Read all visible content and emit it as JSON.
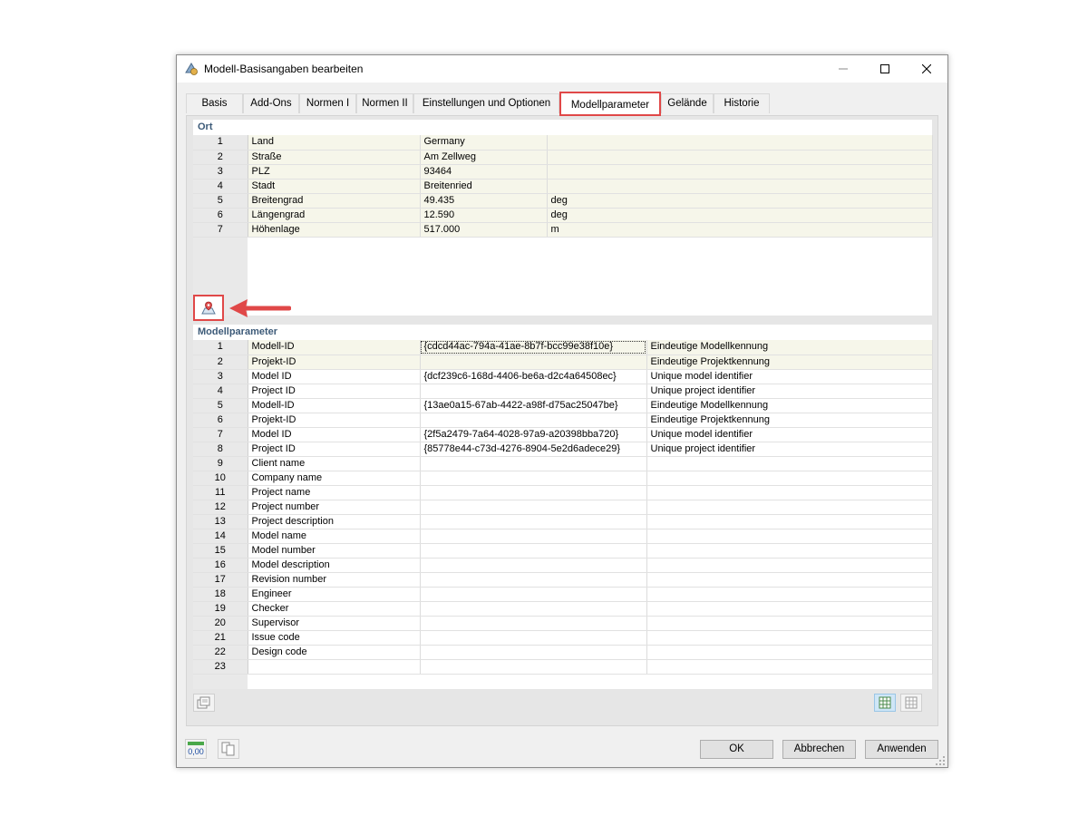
{
  "window": {
    "title": "Modell-Basisangaben bearbeiten"
  },
  "tabs": [
    {
      "label": "Basis"
    },
    {
      "label": "Add-Ons"
    },
    {
      "label": "Normen I"
    },
    {
      "label": "Normen II"
    },
    {
      "label": "Einstellungen und Optionen"
    },
    {
      "label": "Modellparameter",
      "active": true
    },
    {
      "label": "Gelände"
    },
    {
      "label": "Historie"
    }
  ],
  "ort": {
    "title": "Ort",
    "rows": [
      {
        "num": "1",
        "name": "Land",
        "value": "Germany",
        "unit": ""
      },
      {
        "num": "2",
        "name": "Straße",
        "value": "Am Zellweg",
        "unit": ""
      },
      {
        "num": "3",
        "name": "PLZ",
        "value": "93464",
        "unit": ""
      },
      {
        "num": "4",
        "name": "Stadt",
        "value": "Breitenried",
        "unit": ""
      },
      {
        "num": "5",
        "name": "Breitengrad",
        "value": "49.435",
        "unit": "deg"
      },
      {
        "num": "6",
        "name": "Längengrad",
        "value": "12.590",
        "unit": "deg"
      },
      {
        "num": "7",
        "name": "Höhenlage",
        "value": "517.000",
        "unit": "m"
      }
    ]
  },
  "params": {
    "title": "Modellparameter",
    "rows": [
      {
        "num": "1",
        "name": "Modell-ID",
        "value": "{cdcd44ac-794a-41ae-8b7f-bcc99e38f10e}",
        "desc": "Eindeutige Modellkennung"
      },
      {
        "num": "2",
        "name": "Projekt-ID",
        "value": "",
        "desc": "Eindeutige Projektkennung"
      },
      {
        "num": "3",
        "name": "Model ID",
        "value": "{dcf239c6-168d-4406-be6a-d2c4a64508ec}",
        "desc": "Unique model identifier"
      },
      {
        "num": "4",
        "name": "Project ID",
        "value": "",
        "desc": "Unique project identifier"
      },
      {
        "num": "5",
        "name": "Modell-ID",
        "value": "{13ae0a15-67ab-4422-a98f-d75ac25047be}",
        "desc": "Eindeutige Modellkennung"
      },
      {
        "num": "6",
        "name": "Projekt-ID",
        "value": "",
        "desc": "Eindeutige Projektkennung"
      },
      {
        "num": "7",
        "name": "Model ID",
        "value": "{2f5a2479-7a64-4028-97a9-a20398bba720}",
        "desc": "Unique model identifier"
      },
      {
        "num": "8",
        "name": "Project ID",
        "value": "{85778e44-c73d-4276-8904-5e2d6adece29}",
        "desc": "Unique project identifier"
      },
      {
        "num": "9",
        "name": "Client name",
        "value": "",
        "desc": ""
      },
      {
        "num": "10",
        "name": "Company name",
        "value": "",
        "desc": ""
      },
      {
        "num": "11",
        "name": "Project name",
        "value": "",
        "desc": ""
      },
      {
        "num": "12",
        "name": "Project number",
        "value": "",
        "desc": ""
      },
      {
        "num": "13",
        "name": "Project description",
        "value": "",
        "desc": ""
      },
      {
        "num": "14",
        "name": "Model name",
        "value": "",
        "desc": ""
      },
      {
        "num": "15",
        "name": "Model number",
        "value": "",
        "desc": ""
      },
      {
        "num": "16",
        "name": "Model description",
        "value": "",
        "desc": ""
      },
      {
        "num": "17",
        "name": "Revision number",
        "value": "",
        "desc": ""
      },
      {
        "num": "18",
        "name": "Engineer",
        "value": "",
        "desc": ""
      },
      {
        "num": "19",
        "name": "Checker",
        "value": "",
        "desc": ""
      },
      {
        "num": "20",
        "name": "Supervisor",
        "value": "",
        "desc": ""
      },
      {
        "num": "21",
        "name": "Issue code",
        "value": "",
        "desc": ""
      },
      {
        "num": "22",
        "name": "Design code",
        "value": "",
        "desc": ""
      },
      {
        "num": "23",
        "name": "",
        "value": "",
        "desc": ""
      }
    ]
  },
  "footer": {
    "units_icon_text": "0,00",
    "ok": "OK",
    "cancel": "Abbrechen",
    "apply": "Anwenden"
  },
  "colors": {
    "highlight": "#e04848",
    "section_title": "#3c5a78",
    "shaded_row": "#f6f6ea"
  }
}
